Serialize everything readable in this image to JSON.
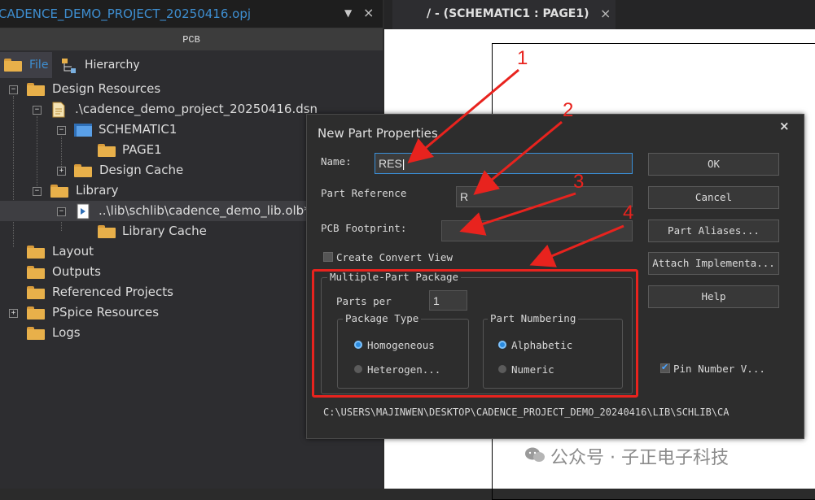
{
  "left_tab": {
    "title": "CADENCE_DEMO_PROJECT_20250416.opj",
    "dropdown_icon": "chevron-down-icon",
    "close_glyph": "×"
  },
  "pcb_header": "PCB",
  "view_tabs": [
    {
      "label": "File"
    },
    {
      "label": "Hierarchy"
    }
  ],
  "tree": {
    "design_resources": "Design Resources",
    "dsn_file": ".\\cadence_demo_project_20250416.dsn",
    "schematic": "SCHEMATIC1",
    "page": "PAGE1",
    "design_cache": "Design Cache",
    "library": "Library",
    "olb_file": "..\\lib\\schlib\\cadence_demo_lib.olb*",
    "library_cache": "Library Cache",
    "layout": "Layout",
    "outputs": "Outputs",
    "referenced_projects": "Referenced Projects",
    "pspice_resources": "PSpice Resources",
    "logs": "Logs"
  },
  "right_tab": {
    "title": "/ - (SCHEMATIC1 : PAGE1)",
    "close_glyph": "×"
  },
  "dialog": {
    "title": "New Part Properties",
    "close_glyph": "×",
    "name_label": "Name:",
    "name_value": "RES",
    "part_ref_label": "Part Reference",
    "part_ref_value": "R",
    "footprint_label": "PCB Footprint:",
    "footprint_value": "",
    "create_convert_label": "Create Convert View",
    "create_convert_checked": false,
    "multi_part_group": "Multiple-Part Package",
    "parts_per_label": "Parts per",
    "parts_per_value": "1",
    "package_type_group": "Package Type",
    "homogeneous": "Homogeneous",
    "heterogeneous": "Heterogen...",
    "package_type_selected": "Homogeneous",
    "part_numbering_group": "Part Numbering",
    "alphabetic": "Alphabetic",
    "numeric": "Numeric",
    "part_numbering_selected": "Alphabetic",
    "buttons": {
      "ok": "OK",
      "cancel": "Cancel",
      "part_aliases": "Part Aliases...",
      "attach_implementation": "Attach Implementa...",
      "help": "Help"
    },
    "pin_number_label": "Pin Number V...",
    "pin_number_checked": true,
    "path": "C:\\USERS\\MAJINWEN\\DESKTOP\\CADENCE_PROJECT_DEMO_20240416\\LIB\\SCHLIB\\CA"
  },
  "annotations": [
    "1",
    "2",
    "3",
    "4"
  ],
  "annotation_color": "#e8231e",
  "watermark": "公众号 · 子正电子科技"
}
